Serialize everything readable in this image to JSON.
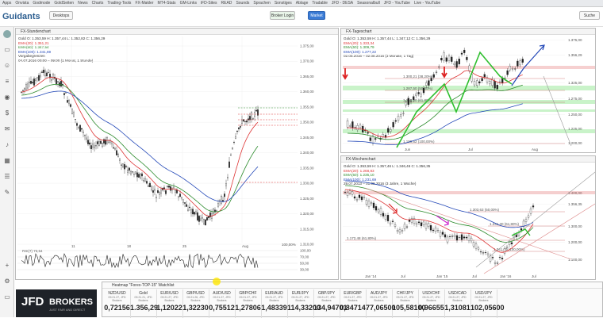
{
  "bookmarks": [
    "Apps",
    "Onvista",
    "Godmode",
    "GoldSeiten",
    "News",
    "Charts",
    "Trading-Tools",
    "FX-Makler",
    "MT4-Stats",
    "GM-Links",
    "iFD-Sites",
    "READ",
    "Sounds",
    "Sprachen",
    "Sonstiges",
    "Ablage",
    "Tradable",
    "JFD - DESA",
    "Seasonalbull",
    "JFD - YouTube",
    "Live - YouTube"
  ],
  "header": {
    "logo": "Guidants",
    "desktop_btn": "Desktops",
    "broker_btn": "Broker Login",
    "market_btn": "Market",
    "search_btn": "Suche"
  },
  "panel_left": {
    "title": "FX-Stundenchart",
    "legend": [
      "Gold  O: 1.353,59  H: 1.357,44  L: 1.352,82  C: 1.356,29",
      "EMA(20): 1.351,21",
      "EMA(50): 1.347,54",
      "EMA(100): 1.341,69",
      "Vorgabegrenzen",
      "04.07.2016 00:00 – 09:00 (1 Monat, 1 Stunde)"
    ],
    "yticks": [
      "1.375,00",
      "1.370,00",
      "1.365,00",
      "1.360,00",
      "1.355,00",
      "1.350,00",
      "1.345,00",
      "1.340,00",
      "1.335,00",
      "1.330,00",
      "1.325,00",
      "1.320,00",
      "1.315,00",
      "1.310,00"
    ],
    "xticks": [
      "11",
      "18",
      "25",
      "Aug"
    ],
    "rsi_label": "RSI(7)  73,54",
    "rsi_ticks": [
      "100,00",
      "70,00",
      "50,00",
      "30,00"
    ],
    "pct": "100,00%"
  },
  "panel_day": {
    "title": "FX-Tageschart",
    "legend": [
      "Gold  O: 1.353,59  H: 1.357,44  L: 1.347,12  C: 1.356,29",
      "EMA(20): 1.333,34",
      "EMA(50): 1.309,79",
      "EMA(100): 1.277,22",
      "02.05.2016 – 02.08.2016 (3 Monate, 1 Tag)"
    ],
    "fib": [
      "1.300,21 (38,20%)",
      "1.287,50 (50,00%)",
      "1.268,00 (61,80%)",
      "1.199,62 (100,00%)"
    ],
    "yticks": [
      "1.375,00",
      "1.356,29",
      "1.325,00",
      "1.275,00",
      "1.250,00",
      "1.225,00",
      "1.200,00"
    ],
    "xticks": [
      "Jun",
      "Jul",
      "Aug"
    ]
  },
  "panel_week": {
    "title": "FX-Wochenchart",
    "legend": [
      "Gold  O: 1.353,59  H: 1.357,46  L: 1.346,46  C: 1.356,35",
      "EMA(20): 1.268,83",
      "EMA(50): 1.235,10",
      "EMA(100): 1.231,69",
      "29.07.2013 – 01.08.2016 (3 Jahre, 1 Woche)"
    ],
    "fib": [
      "1.303,63 (50,00%)",
      "1.241,30 (61,80%)",
      "1.172,48 (61,80%)",
      "1.041,00 (100,00%)"
    ],
    "yticks": [
      "1.400,00",
      "1.356,35",
      "1.300,00",
      "1.200,00",
      "1.100,00"
    ],
    "xticks": [
      "Jan '14",
      "Jul",
      "Jan '15",
      "Jul",
      "Jan '16",
      "Jul"
    ]
  },
  "heatmap": {
    "title": "Heatmap  \"Forex-TOP-15\" Watchlist",
    "tiles": [
      {
        "name": "NZD/USD",
        "date": "09.21.27, JFD Brokers",
        "value": "0,72156"
      },
      {
        "name": "Gold",
        "date": "09.21.21, JFD Brokers",
        "value": "1.356,29"
      },
      {
        "name": "EUR/USD",
        "date": "09.21.27, JFD Brokers",
        "value": "1,12022"
      },
      {
        "name": "GBP/USD",
        "date": "09.21.26, JFD Brokers",
        "value": "1,32230"
      },
      {
        "name": "AUD/USD",
        "date": "09.21.27, JFD Brokers",
        "value": "0,75512"
      },
      {
        "name": "GBP/CHF",
        "date": "09.21.27, JFD Brokers",
        "value": "1,27806"
      },
      {
        "name": "EUR/AUD",
        "date": "09.21.27, JFD Brokers",
        "value": "1,48339"
      },
      {
        "name": "EUR/JPY",
        "date": "09.21.27, JFD Brokers",
        "value": "114,33200"
      },
      {
        "name": "GBP/JPY",
        "date": "09.21.27, JFD Brokers",
        "value": "134,94701"
      },
      {
        "name": "EUR/GBP",
        "date": "09.21.27, JFD Brokers",
        "value": "0,84714"
      },
      {
        "name": "AUD/JPY",
        "date": "09.21.27, JFD Brokers",
        "value": "77,06500"
      },
      {
        "name": "CHF/JPY",
        "date": "09.21.27, JFD Brokers",
        "value": "105,58100"
      },
      {
        "name": "USD/CHF",
        "date": "09.21.27, JFD Brokers",
        "value": "0,96655"
      },
      {
        "name": "USD/CAD",
        "date": "09.21.27, JFD Brokers",
        "value": "1,31081"
      },
      {
        "name": "USD/JPY",
        "date": "09.21.27, JFD Brokers",
        "value": "102,05600"
      }
    ]
  },
  "jfd": {
    "brand": "JFD",
    "brokers": "BROKERS",
    "tagline": "JUST FAIR AND DIRECT"
  }
}
